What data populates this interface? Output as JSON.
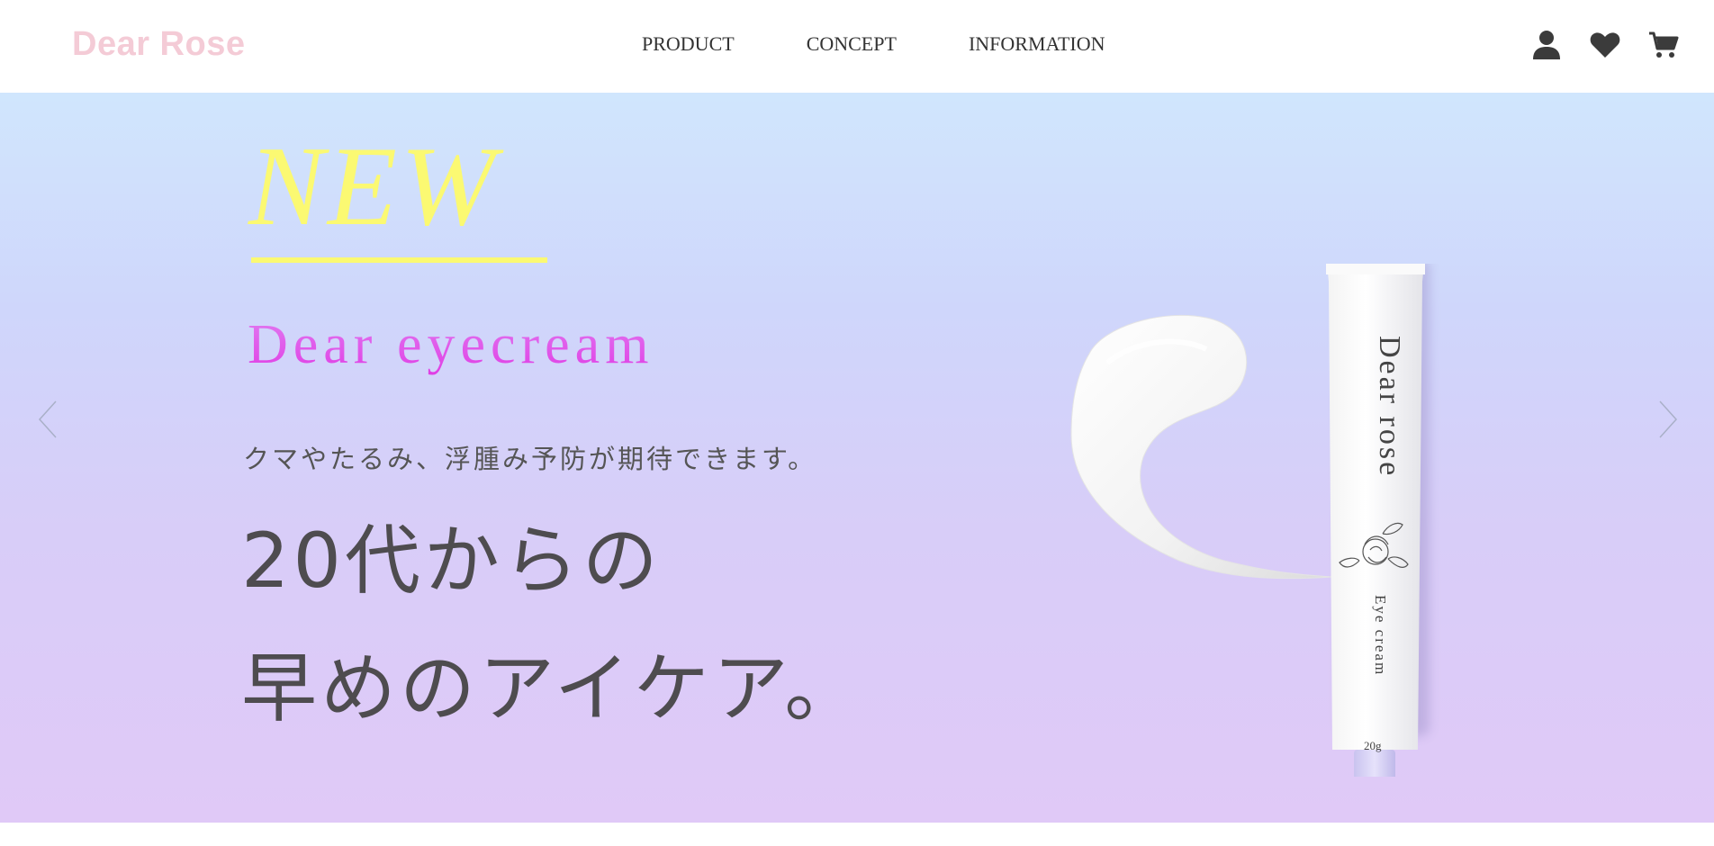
{
  "header": {
    "logo": "Dear Rose",
    "nav": [
      "PRODUCT",
      "CONCEPT",
      "INFORMATION"
    ],
    "icons": [
      "user-icon",
      "heart-icon",
      "cart-icon"
    ]
  },
  "hero": {
    "badge": "NEW",
    "product_name": "Dear eyecream",
    "subtitle": "クマやたるみ、浮腫み予防が期待できます。",
    "headline_line1": "20代からの",
    "headline_line2": "早めのアイケア。",
    "tube": {
      "brand": "Dear rose",
      "type": "Eye cream",
      "weight": "20g"
    }
  },
  "colors": {
    "logo": "#f4cbd6",
    "badge": "#fbf972",
    "product_name": "#e35fe6",
    "headline": "#4e4c4f",
    "hero_top": "#d0e6fd",
    "hero_bottom": "#e0c9f7"
  }
}
